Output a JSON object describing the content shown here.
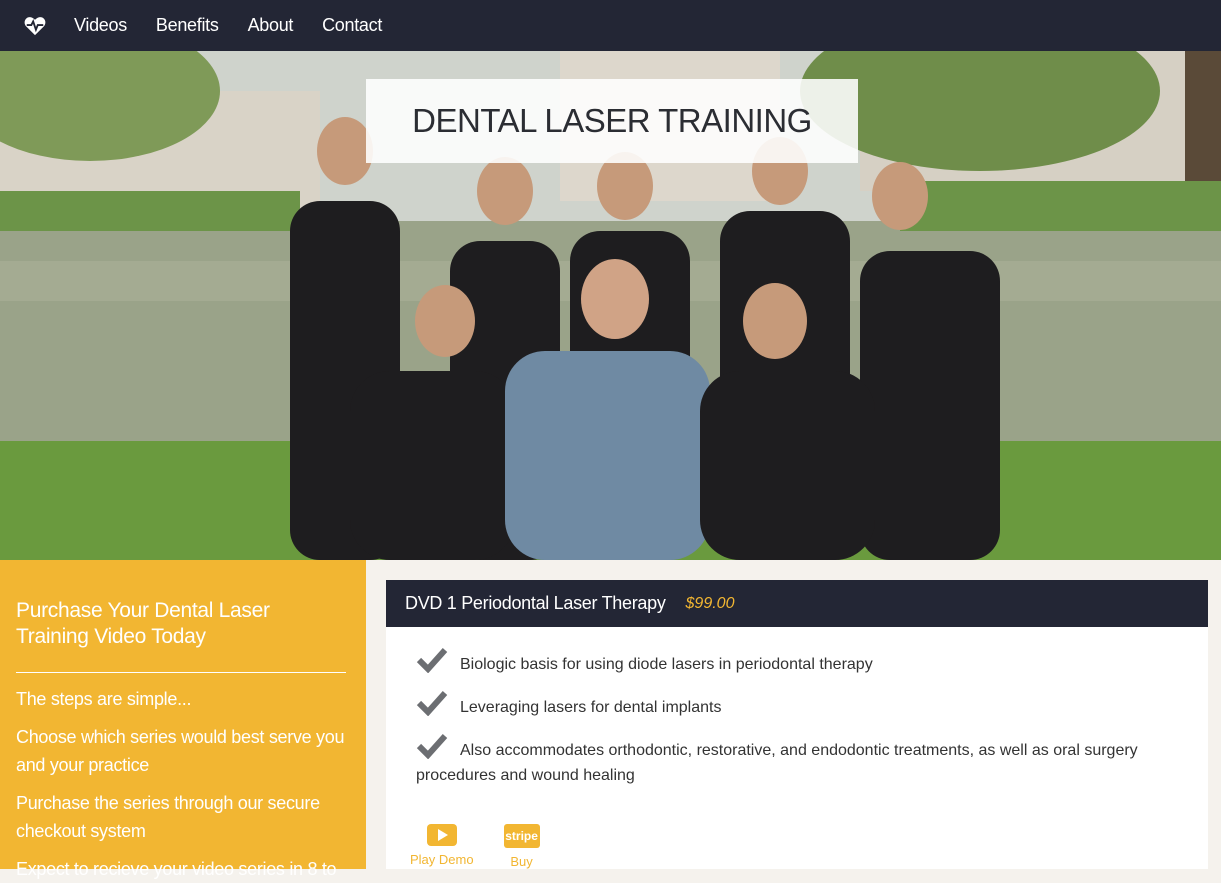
{
  "nav": {
    "logo_icon": "heartbeat-icon",
    "links": [
      "Videos",
      "Benefits",
      "About",
      "Contact"
    ]
  },
  "hero": {
    "title": "DENTAL LASER TRAINING"
  },
  "sidebar": {
    "heading": "Purchase Your Dental Laser Training Video Today",
    "steps": [
      "The steps are simple...",
      "Choose which series would best serve you and your practice",
      "Purchase the series through our secure checkout system",
      "Expect to recieve your video series in 8 to"
    ]
  },
  "product": {
    "title": "DVD 1 Periodontal Laser Therapy",
    "price": "$99.00",
    "features": [
      "Biologic basis for using diode lasers in periodontal therapy",
      "Leveraging lasers for dental implants",
      "Also accommodates orthodontic, restorative, and endodontic treatments, as well as oral surgery procedures and wound healing"
    ],
    "actions": {
      "play_label": "Play Demo",
      "stripe_text": "stripe",
      "buy_label": "Buy"
    }
  },
  "colors": {
    "nav_bg": "#232635",
    "accent": "#f2b632",
    "panel_bg": "#f5f2ed"
  }
}
